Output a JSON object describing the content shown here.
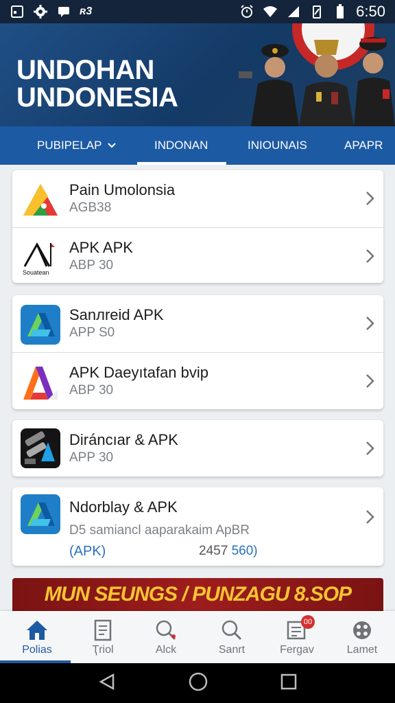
{
  "status_bar": {
    "carrier_text": "ʀ3",
    "time": "6:50"
  },
  "header": {
    "title_line1": "UNDOHAN",
    "title_line2": "UNDONESIA"
  },
  "tabs": [
    {
      "label": "PUBIPELAP",
      "has_dropdown": true
    },
    {
      "label": "INDONAN",
      "active": true
    },
    {
      "label": "INIOUNAIS"
    },
    {
      "label": "APAPR"
    }
  ],
  "cards": [
    {
      "rows": [
        {
          "title": "Pain Umolonsia",
          "subtitle": "AGB38",
          "icon": "triangle-app-icon"
        },
        {
          "title": "APK APK",
          "subtitle": "ABP 30",
          "icon": "tent-logo-icon",
          "icon_text": "Souatean"
        }
      ]
    },
    {
      "rows": [
        {
          "title": "Sanлreid APK",
          "subtitle": "APP S0",
          "icon": "blue-a-app-icon"
        },
        {
          "title": "APK Daeyıtafan bvip",
          "subtitle": "ABP 30",
          "icon": "colorful-a-app-icon"
        }
      ]
    },
    {
      "rows": [
        {
          "title": "Diráncıar & APK",
          "subtitle": "APP 30",
          "icon": "dark-tool-app-icon"
        }
      ]
    },
    {
      "rows": [
        {
          "title": "Ndorblay & APK",
          "subtitle": "D5 samiancl aaparakaim ApBR",
          "extra_left": "(APK)",
          "extra_right_num": "2457",
          "extra_right_accent": "560)",
          "icon": "blue-a-app-icon"
        }
      ]
    }
  ],
  "banner": {
    "text": "MUN SEUNGS / PUNZAGU 8.SOP"
  },
  "bottom_nav": [
    {
      "label": "Polias",
      "icon": "home-icon",
      "active": true
    },
    {
      "label": "Ҭriol",
      "icon": "document-icon"
    },
    {
      "label": "Alck",
      "icon": "search-pin-icon"
    },
    {
      "label": "Sanrt",
      "icon": "search-icon"
    },
    {
      "label": "Fergav",
      "icon": "notification-board-icon",
      "badge": "00"
    },
    {
      "label": "Lamet",
      "icon": "grid-circle-icon"
    }
  ],
  "colors": {
    "primary": "#1d5aa4",
    "header_dark": "#143a66",
    "banner_red": "#9e1d1d",
    "banner_gold": "#f7c531"
  }
}
